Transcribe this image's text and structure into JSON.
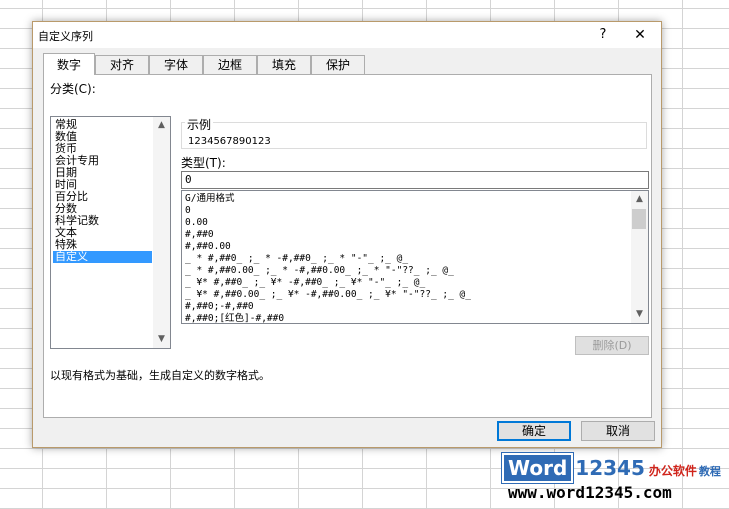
{
  "dialog": {
    "title": "自定义序列",
    "help": "?",
    "close": "✕"
  },
  "tabs": [
    "数字",
    "对齐",
    "字体",
    "边框",
    "填充",
    "保护"
  ],
  "category": {
    "label": "分类(C):",
    "items": [
      "常规",
      "数值",
      "货币",
      "会计专用",
      "日期",
      "时间",
      "百分比",
      "分数",
      "科学记数",
      "文本",
      "特殊",
      "自定义"
    ],
    "selected": "自定义"
  },
  "sample": {
    "label": "示例",
    "value": "1234567890123"
  },
  "type": {
    "label": "类型(T):",
    "value": "0"
  },
  "formats": [
    "G/通用格式",
    "0",
    "0.00",
    "#,##0",
    "#,##0.00",
    "_ * #,##0_ ;_ * -#,##0_ ;_ * \"-\"_ ;_ @_",
    "_ * #,##0.00_ ;_ * -#,##0.00_ ;_ * \"-\"??_ ;_ @_",
    "_ ¥* #,##0_ ;_ ¥* -#,##0_ ;_ ¥* \"-\"_ ;_ @_",
    "_ ¥* #,##0.00_ ;_ ¥* -#,##0.00_ ;_ ¥* \"-\"??_ ;_ @_",
    "#,##0;-#,##0",
    "#,##0;[红色]-#,##0"
  ],
  "buttons": {
    "delete": "删除(D)",
    "ok": "确定",
    "cancel": "取消"
  },
  "description": "以现有格式为基础，生成自定义的数字格式。",
  "watermark": {
    "word": "Word",
    "num": "12345",
    "cn1": "办公软件",
    "cn2": "教程",
    "url": "www.word12345.com"
  }
}
